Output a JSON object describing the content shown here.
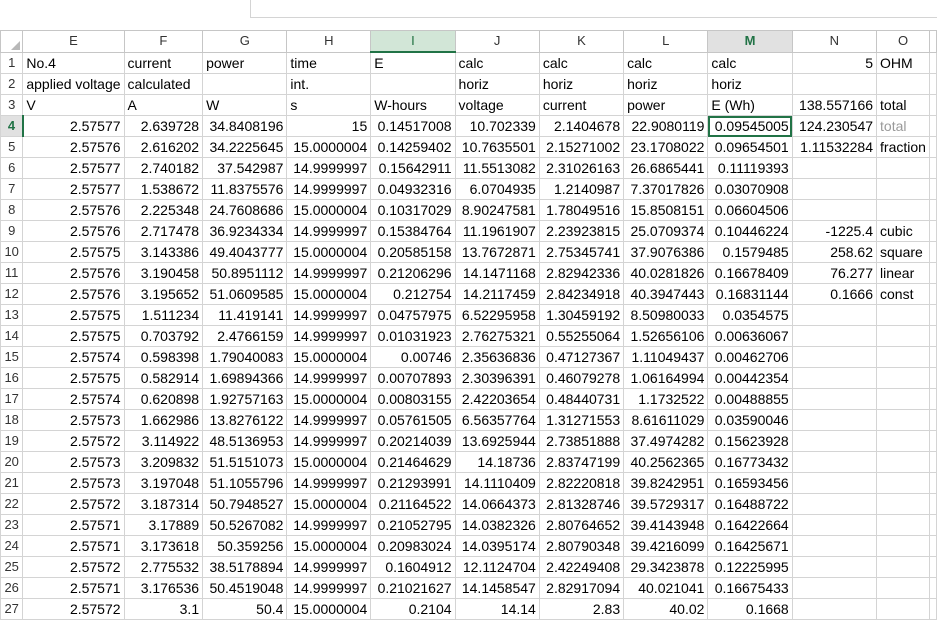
{
  "columns": [
    "E",
    "F",
    "G",
    "H",
    "I",
    "J",
    "K",
    "L",
    "M",
    "N",
    "O"
  ],
  "active_column": "I",
  "selected_column": "M",
  "selected_row": "4",
  "rows": [
    {
      "n": "1",
      "cells": [
        "No.4",
        "current",
        "power",
        "time",
        "E",
        "calc",
        "calc",
        "calc",
        "calc",
        "5",
        "OHM"
      ]
    },
    {
      "n": "2",
      "cells": [
        "applied voltage",
        "calculated",
        "",
        "int.",
        "",
        "horiz",
        "horiz",
        "horiz",
        "horiz",
        "",
        ""
      ]
    },
    {
      "n": "3",
      "cells": [
        "V",
        "A",
        "W",
        "s",
        "W-hours",
        "voltage",
        "current",
        "power",
        "E (Wh)",
        "138.557166",
        "total"
      ]
    },
    {
      "n": "4",
      "cells": [
        "2.57577",
        "2.639728",
        "34.8408196",
        "15",
        "0.14517008",
        "10.702339",
        "2.1404678",
        "22.9080119",
        "0.09545005",
        "124.230547",
        "total"
      ]
    },
    {
      "n": "5",
      "cells": [
        "2.57576",
        "2.616202",
        "34.2225645",
        "15.0000004",
        "0.14259402",
        "10.7635501",
        "2.15271002",
        "23.1708022",
        "0.09654501",
        "1.11532284",
        "fraction"
      ]
    },
    {
      "n": "6",
      "cells": [
        "2.57577",
        "2.740182",
        "37.542987",
        "14.9999997",
        "0.15642911",
        "11.5513082",
        "2.31026163",
        "26.6865441",
        "0.11119393",
        "",
        ""
      ]
    },
    {
      "n": "7",
      "cells": [
        "2.57577",
        "1.538672",
        "11.8375576",
        "14.9999997",
        "0.04932316",
        "6.0704935",
        "1.2140987",
        "7.37017826",
        "0.03070908",
        "",
        ""
      ]
    },
    {
      "n": "8",
      "cells": [
        "2.57576",
        "2.225348",
        "24.7608686",
        "15.0000004",
        "0.10317029",
        "8.90247581",
        "1.78049516",
        "15.8508151",
        "0.06604506",
        "",
        ""
      ]
    },
    {
      "n": "9",
      "cells": [
        "2.57576",
        "2.717478",
        "36.9234334",
        "14.9999997",
        "0.15384764",
        "11.1961907",
        "2.23923815",
        "25.0709374",
        "0.10446224",
        "-1225.4",
        "cubic"
      ]
    },
    {
      "n": "10",
      "cells": [
        "2.57575",
        "3.143386",
        "49.4043777",
        "15.0000004",
        "0.20585158",
        "13.7672871",
        "2.75345741",
        "37.9076386",
        "0.1579485",
        "258.62",
        "square"
      ]
    },
    {
      "n": "11",
      "cells": [
        "2.57576",
        "3.190458",
        "50.8951112",
        "14.9999997",
        "0.21206296",
        "14.1471168",
        "2.82942336",
        "40.0281826",
        "0.16678409",
        "76.277",
        "linear"
      ]
    },
    {
      "n": "12",
      "cells": [
        "2.57576",
        "3.195652",
        "51.0609585",
        "15.0000004",
        "0.212754",
        "14.2117459",
        "2.84234918",
        "40.3947443",
        "0.16831144",
        "0.1666",
        "const"
      ]
    },
    {
      "n": "13",
      "cells": [
        "2.57575",
        "1.511234",
        "11.419141",
        "14.9999997",
        "0.04757975",
        "6.52295958",
        "1.30459192",
        "8.50980033",
        "0.0354575",
        "",
        ""
      ]
    },
    {
      "n": "14",
      "cells": [
        "2.57575",
        "0.703792",
        "2.4766159",
        "14.9999997",
        "0.01031923",
        "2.76275321",
        "0.55255064",
        "1.52656106",
        "0.00636067",
        "",
        ""
      ]
    },
    {
      "n": "15",
      "cells": [
        "2.57574",
        "0.598398",
        "1.79040083",
        "15.0000004",
        "0.00746",
        "2.35636836",
        "0.47127367",
        "1.11049437",
        "0.00462706",
        "",
        ""
      ]
    },
    {
      "n": "16",
      "cells": [
        "2.57575",
        "0.582914",
        "1.69894366",
        "14.9999997",
        "0.00707893",
        "2.30396391",
        "0.46079278",
        "1.06164994",
        "0.00442354",
        "",
        ""
      ]
    },
    {
      "n": "17",
      "cells": [
        "2.57574",
        "0.620898",
        "1.92757163",
        "15.0000004",
        "0.00803155",
        "2.42203654",
        "0.48440731",
        "1.1732522",
        "0.00488855",
        "",
        ""
      ]
    },
    {
      "n": "18",
      "cells": [
        "2.57573",
        "1.662986",
        "13.8276122",
        "14.9999997",
        "0.05761505",
        "6.56357764",
        "1.31271553",
        "8.61611029",
        "0.03590046",
        "",
        ""
      ]
    },
    {
      "n": "19",
      "cells": [
        "2.57572",
        "3.114922",
        "48.5136953",
        "14.9999997",
        "0.20214039",
        "13.6925944",
        "2.73851888",
        "37.4974282",
        "0.15623928",
        "",
        ""
      ]
    },
    {
      "n": "20",
      "cells": [
        "2.57573",
        "3.209832",
        "51.5151073",
        "15.0000004",
        "0.21464629",
        "14.18736",
        "2.83747199",
        "40.2562365",
        "0.16773432",
        "",
        ""
      ]
    },
    {
      "n": "21",
      "cells": [
        "2.57573",
        "3.197048",
        "51.1055796",
        "14.9999997",
        "0.21293991",
        "14.1110409",
        "2.82220818",
        "39.8242951",
        "0.16593456",
        "",
        ""
      ]
    },
    {
      "n": "22",
      "cells": [
        "2.57572",
        "3.187314",
        "50.7948527",
        "15.0000004",
        "0.21164522",
        "14.0664373",
        "2.81328746",
        "39.5729317",
        "0.16488722",
        "",
        ""
      ]
    },
    {
      "n": "23",
      "cells": [
        "2.57571",
        "3.17889",
        "50.5267082",
        "14.9999997",
        "0.21052795",
        "14.0382326",
        "2.80764652",
        "39.4143948",
        "0.16422664",
        "",
        ""
      ]
    },
    {
      "n": "24",
      "cells": [
        "2.57571",
        "3.173618",
        "50.359256",
        "15.0000004",
        "0.20983024",
        "14.0395174",
        "2.80790348",
        "39.4216099",
        "0.16425671",
        "",
        ""
      ]
    },
    {
      "n": "25",
      "cells": [
        "2.57572",
        "2.775532",
        "38.5178894",
        "14.9999997",
        "0.1604912",
        "12.1124704",
        "2.42249408",
        "29.3423878",
        "0.12225995",
        "",
        ""
      ]
    },
    {
      "n": "26",
      "cells": [
        "2.57571",
        "3.176536",
        "50.4519048",
        "14.9999997",
        "0.21021627",
        "14.1458547",
        "2.82917094",
        "40.021041",
        "0.16675433",
        "",
        ""
      ]
    },
    {
      "n": "27",
      "cells": [
        "2.57572",
        "3.1",
        "50.4",
        "15.0000004",
        "0.2104",
        "14.14",
        "2.83",
        "40.02",
        "0.1668",
        "",
        ""
      ]
    }
  ]
}
